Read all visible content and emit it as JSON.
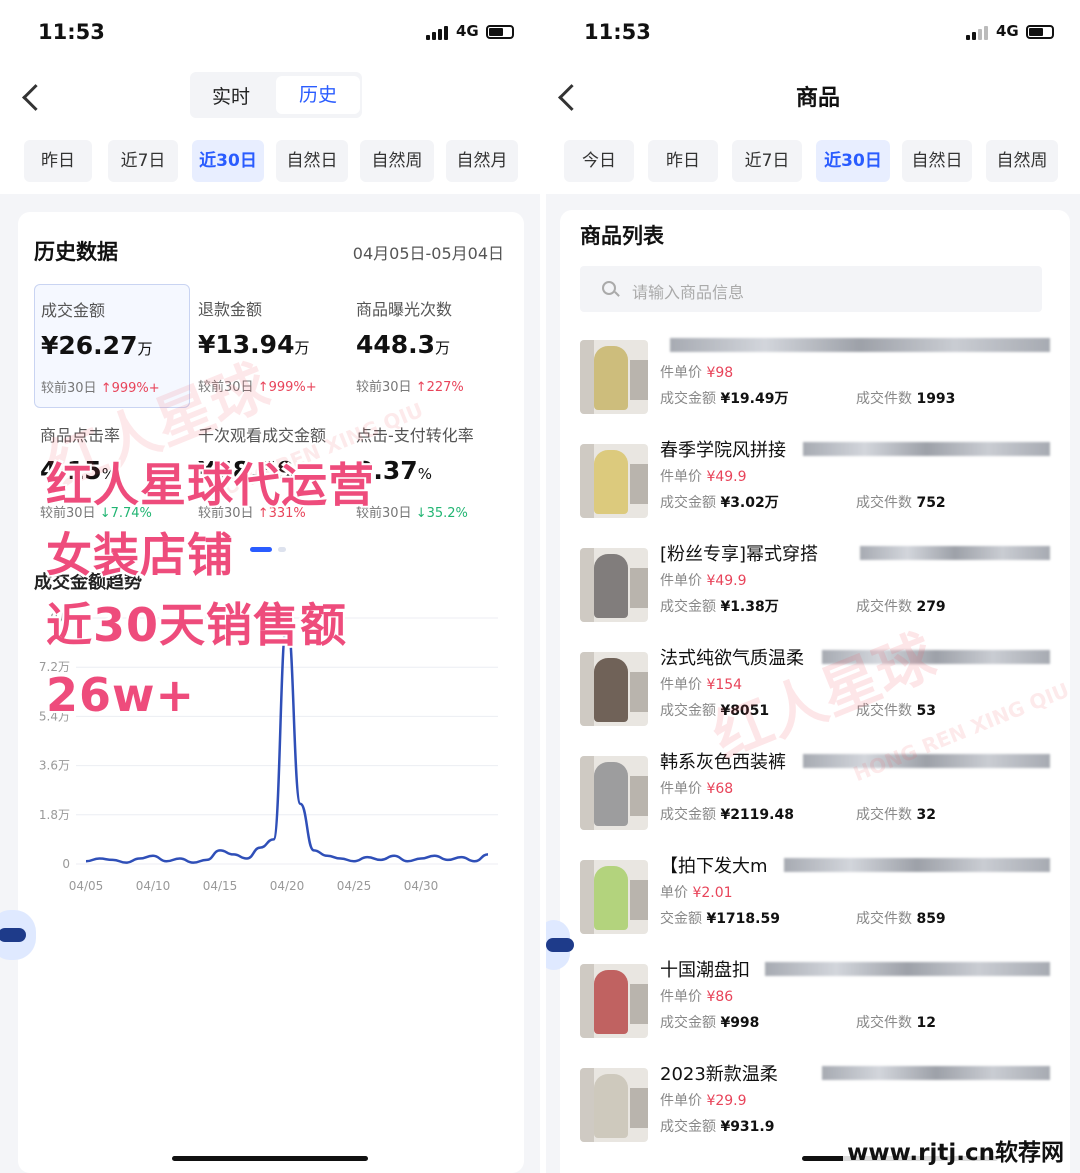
{
  "left": {
    "status": {
      "time": "11:53",
      "network": "4G"
    },
    "tabs": [
      {
        "label": "实时",
        "active": false
      },
      {
        "label": "历史",
        "active": true
      }
    ],
    "date_filters": [
      "昨日",
      "近7日",
      "近30日",
      "自然日",
      "自然周",
      "自然月"
    ],
    "date_active": "近30日",
    "card": {
      "title": "历史数据",
      "date_range": "04月05日-05月04日",
      "metrics": [
        {
          "label": "成交金额",
          "value": "¥26.27",
          "unit": "万",
          "compare_label": "较前30日",
          "change": "↑999%+",
          "direction": "up",
          "selected": true
        },
        {
          "label": "退款金额",
          "value": "¥13.94",
          "unit": "万",
          "compare_label": "较前30日",
          "change": "↑999%+",
          "direction": "up",
          "selected": false
        },
        {
          "label": "商品曝光次数",
          "value": "448.3",
          "unit": "万",
          "compare_label": "较前30日",
          "change": "↑227%",
          "direction": "up",
          "selected": false
        },
        {
          "label": "商品点击率",
          "value": "4.15",
          "unit": "%",
          "compare_label": "较前30日",
          "change": "↓7.74%",
          "direction": "down",
          "selected": false
        },
        {
          "label": "千次观看成交金额",
          "value": "¥58.59",
          "unit": "",
          "compare_label": "较前30日",
          "change": "↑331%",
          "direction": "up",
          "selected": false
        },
        {
          "label": "点击-支付转化率",
          "value": "2.37",
          "unit": "%",
          "compare_label": "较前30日",
          "change": "↓35.2%",
          "direction": "down",
          "selected": false
        }
      ],
      "trend_title": "成交金额趋势"
    },
    "overlay_lines": [
      "红人星球代运营",
      "女装店铺",
      "近30天销售额",
      "26w+"
    ],
    "watermark": {
      "text": "红人星球",
      "pinyin": "HONG REN XING QIU"
    }
  },
  "chart_data": {
    "type": "line",
    "title": "成交金额趋势",
    "xlabel": "",
    "ylabel": "",
    "y_tick_labels": [
      "0",
      "1.8万",
      "3.6万",
      "5.4万",
      "7.2万",
      "9万"
    ],
    "y_ticks": [
      0,
      1.8,
      3.6,
      5.4,
      7.2,
      9
    ],
    "x_tick_labels": [
      "04/05",
      "04/10",
      "04/15",
      "04/20",
      "04/25",
      "04/30"
    ],
    "ylim": [
      0,
      9
    ],
    "grid": true,
    "color": "#2f4fb8",
    "series": [
      {
        "values": [
          0.1,
          0.2,
          0.15,
          0.05,
          0.2,
          0.3,
          0.1,
          0.2,
          0.05,
          0.15,
          0.5,
          0.35,
          0.2,
          0.6,
          0.9,
          8.9,
          2.2,
          0.5,
          0.3,
          0.2,
          0.1,
          0.25,
          0.15,
          0.3,
          0.1,
          0.2,
          0.3,
          0.15,
          0.25,
          0.1,
          0.35
        ]
      }
    ]
  },
  "right": {
    "status": {
      "time": "11:53",
      "network": "4G"
    },
    "title": "商品",
    "date_filters": [
      "今日",
      "昨日",
      "近7日",
      "近30日",
      "自然日",
      "自然周"
    ],
    "date_active": "近30日",
    "list_title": "商品列表",
    "search_placeholder": "请输入商品信息",
    "products": [
      {
        "name": "",
        "price_label": "件单价",
        "price": "¥98",
        "amount_label": "成交金额",
        "amount": "¥19.49万",
        "count_label": "成交件数",
        "count": "1993",
        "color": "#c8b56a"
      },
      {
        "name": "春季学院风拼接",
        "price_label": "件单价",
        "price": "¥49.9",
        "amount_label": "成交金额",
        "amount": "¥3.02万",
        "count_label": "成交件数",
        "count": "752",
        "color": "#d9c46b"
      },
      {
        "name": "[粉丝专享]幂式穿搭",
        "price_label": "件单价",
        "price": "¥49.9",
        "amount_label": "成交金额",
        "amount": "¥1.38万",
        "count_label": "成交件数",
        "count": "279",
        "color": "#6e6a6a"
      },
      {
        "name": "法式纯欲气质温柔",
        "price_label": "件单价",
        "price": "¥154",
        "amount_label": "成交金额",
        "amount": "¥8051",
        "count_label": "成交件数",
        "count": "53",
        "color": "#5b4a3f"
      },
      {
        "name": "韩系灰色西装裤",
        "price_label": "件单价",
        "price": "¥68",
        "amount_label": "成交金额",
        "amount": "¥2119.48",
        "count_label": "成交件数",
        "count": "32",
        "color": "#8f8f92"
      },
      {
        "name": "【拍下发大m",
        "price_label": "单价",
        "price": "¥2.01",
        "amount_label": "交金额",
        "amount": "¥1718.59",
        "count_label": "成交件数",
        "count": "859",
        "color": "#a9cf6b"
      },
      {
        "name": "十国潮盘扣",
        "price_label": "件单价",
        "price": "¥86",
        "amount_label": "成交金额",
        "amount": "¥998",
        "count_label": "成交件数",
        "count": "12",
        "color": "#b84a4a"
      },
      {
        "name": "2023新款温柔",
        "price_label": "件单价",
        "price": "¥29.9",
        "amount_label": "成交金额",
        "amount": "¥931.9",
        "count_label": "",
        "count": "",
        "color": "#c9c3b6"
      }
    ],
    "watermark": {
      "text": "红人星球",
      "pinyin": "HONG REN XING QIU"
    }
  },
  "site_watermark": "www.rjtj.cn软荐网"
}
